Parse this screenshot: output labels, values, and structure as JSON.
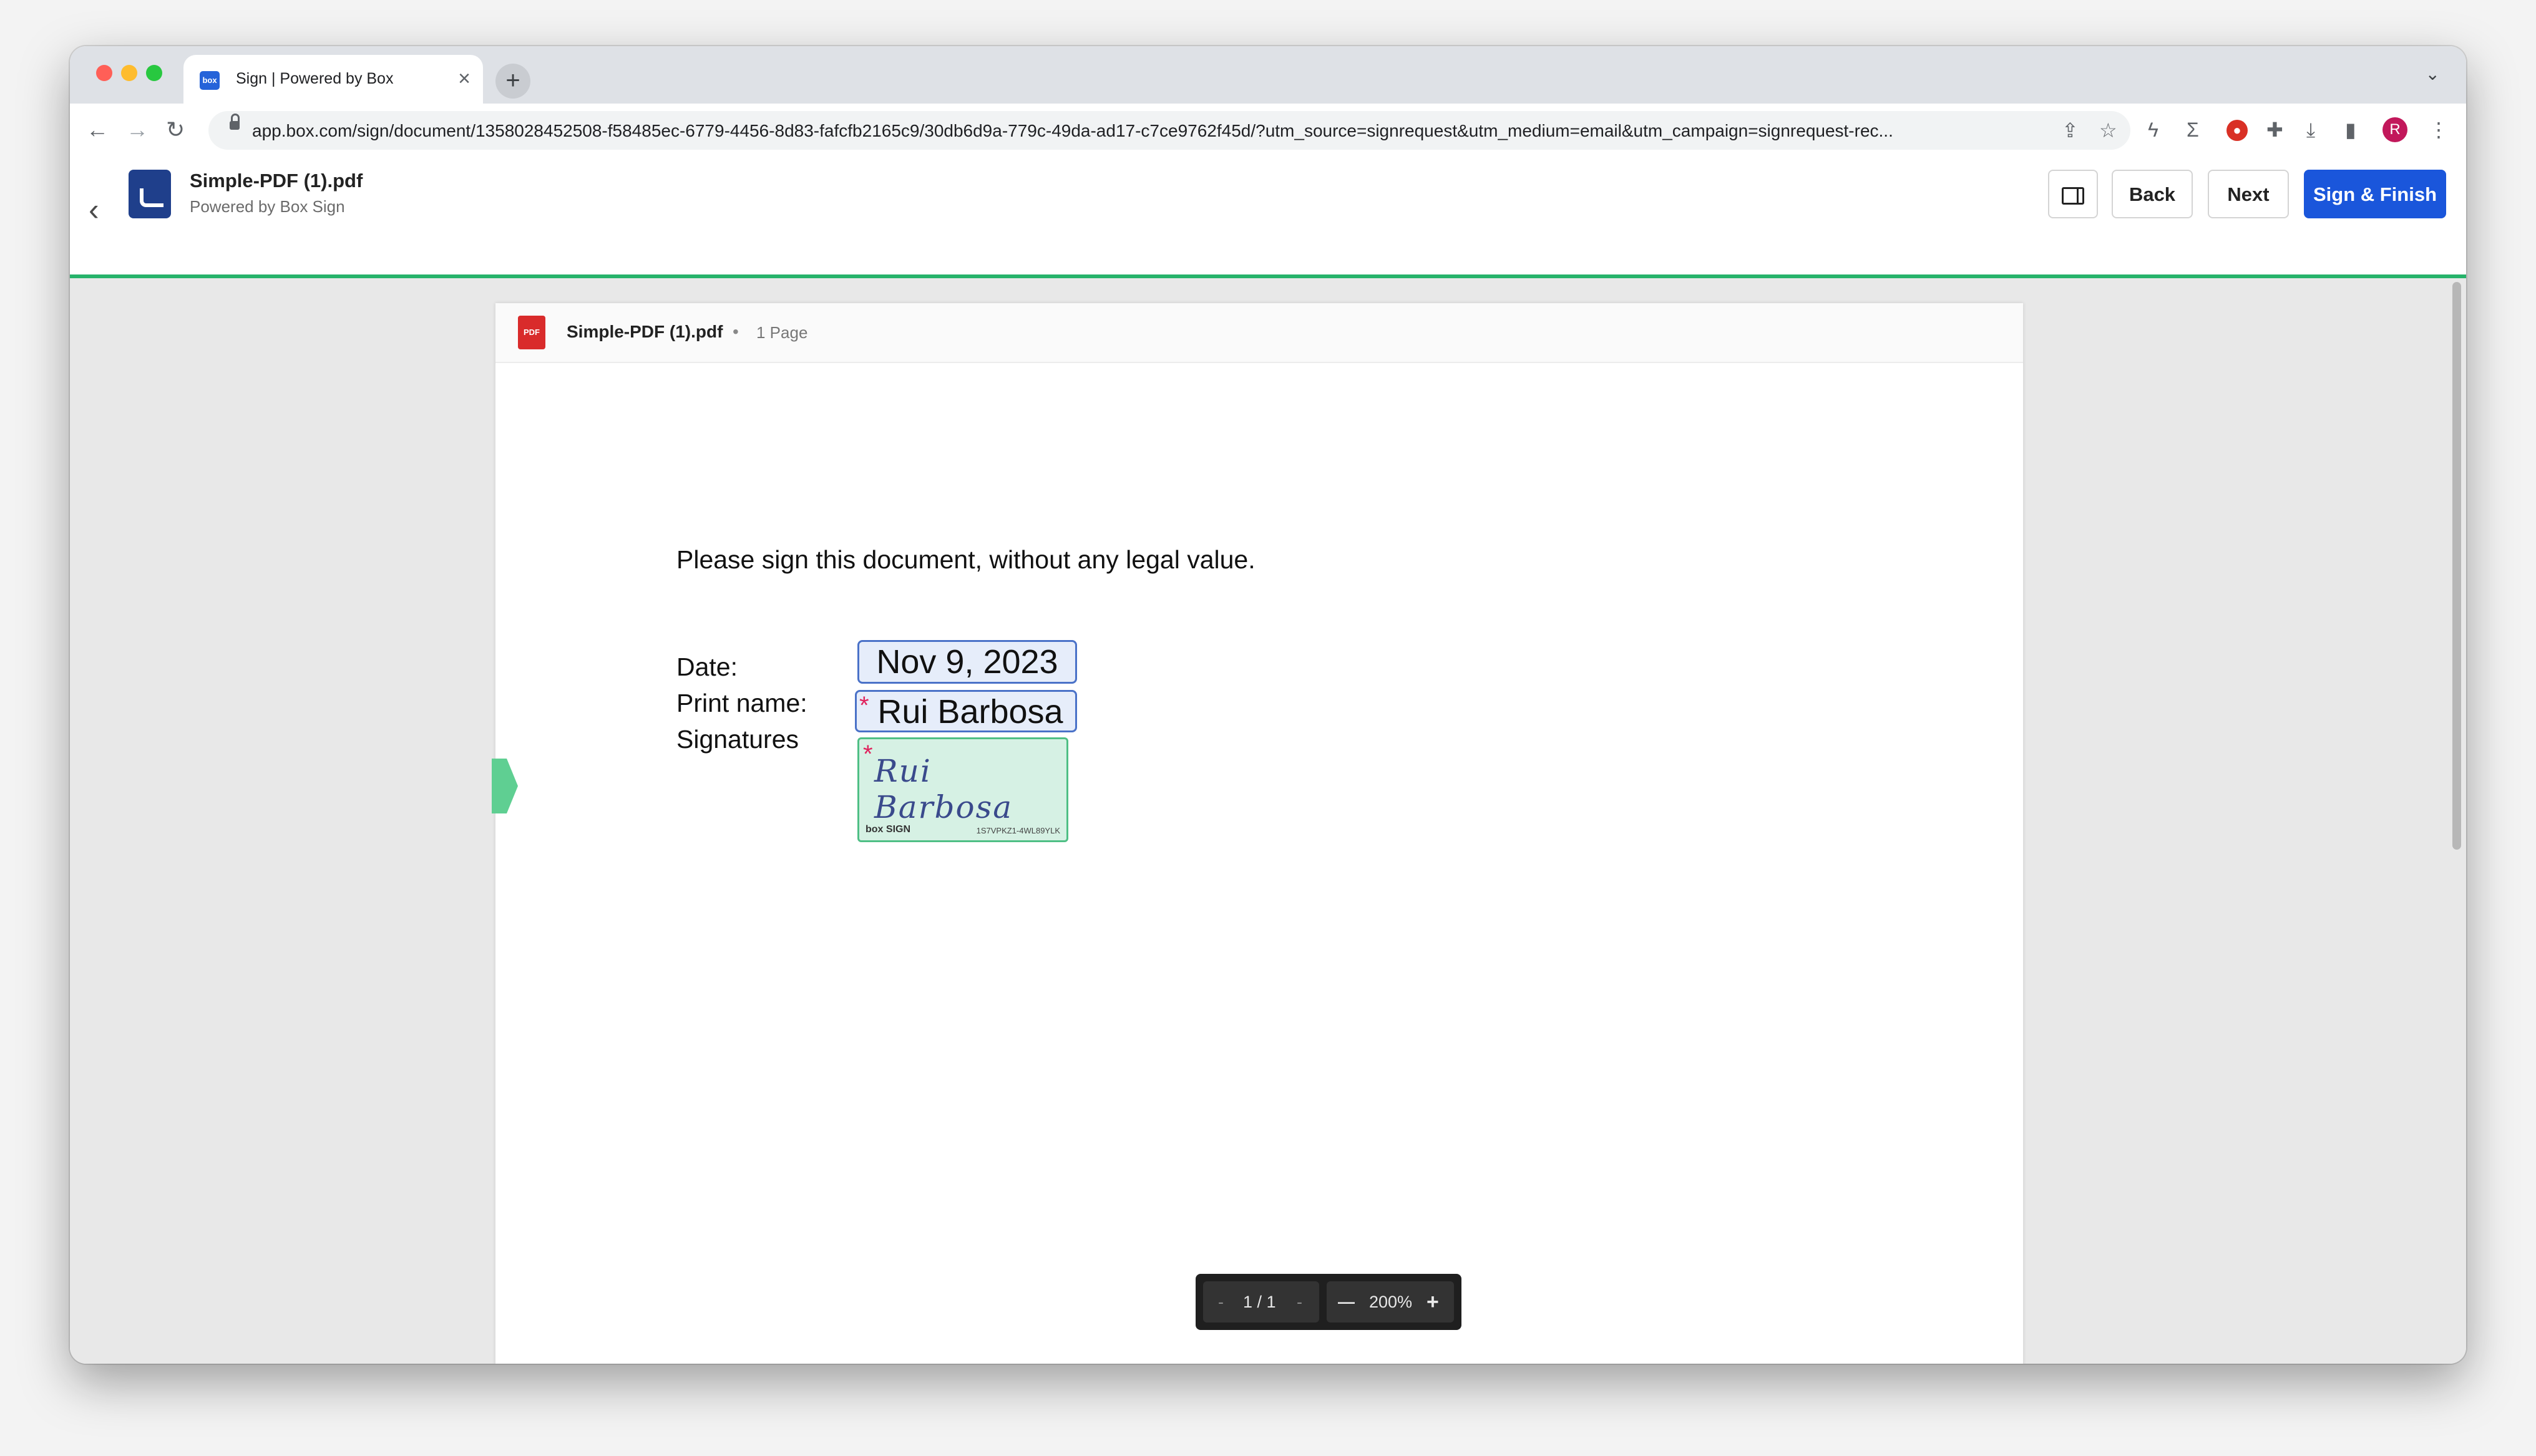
{
  "browser": {
    "tab_title": "Sign | Powered by Box",
    "tab_favicon": "box",
    "new_tab": "+",
    "url": "app.box.com/sign/document/1358028452508-f58485ec-6779-4456-8d83-fafcfb2165c9/30db6d9a-779c-49da-ad17-c7ce9762f45d/?utm_source=signrequest&utm_medium=email&utm_campaign=signrequest-rec...",
    "profile_initial": "R"
  },
  "header": {
    "file_name": "Simple-PDF (1).pdf",
    "powered_by": "Powered by Box Sign",
    "back_label": "Back",
    "next_label": "Next",
    "sign_finish_label": "Sign & Finish",
    "accent_color": "#1a56db",
    "progress_color": "#26b36a"
  },
  "document": {
    "file_name": "Simple-PDF (1).pdf",
    "separator": "•",
    "page_count": "1 Page",
    "instruction": "Please sign this document, without any legal value.",
    "date_label": "Date:",
    "print_name_label": "Print name:",
    "signatures_label": "Signatures",
    "date_value": "Nov 9, 2023",
    "print_name_value": "Rui Barbosa",
    "required_marker": "*",
    "signature_text": "Rui Barbosa",
    "signature_brand": "box SIGN",
    "signature_code": "1S7VPKZ1-4WL89YLK"
  },
  "zoom": {
    "prev_page": "-",
    "page_indicator": "1 / 1",
    "next_page": "-",
    "zoom_out": "—",
    "zoom_level": "200%",
    "zoom_in": "+"
  }
}
